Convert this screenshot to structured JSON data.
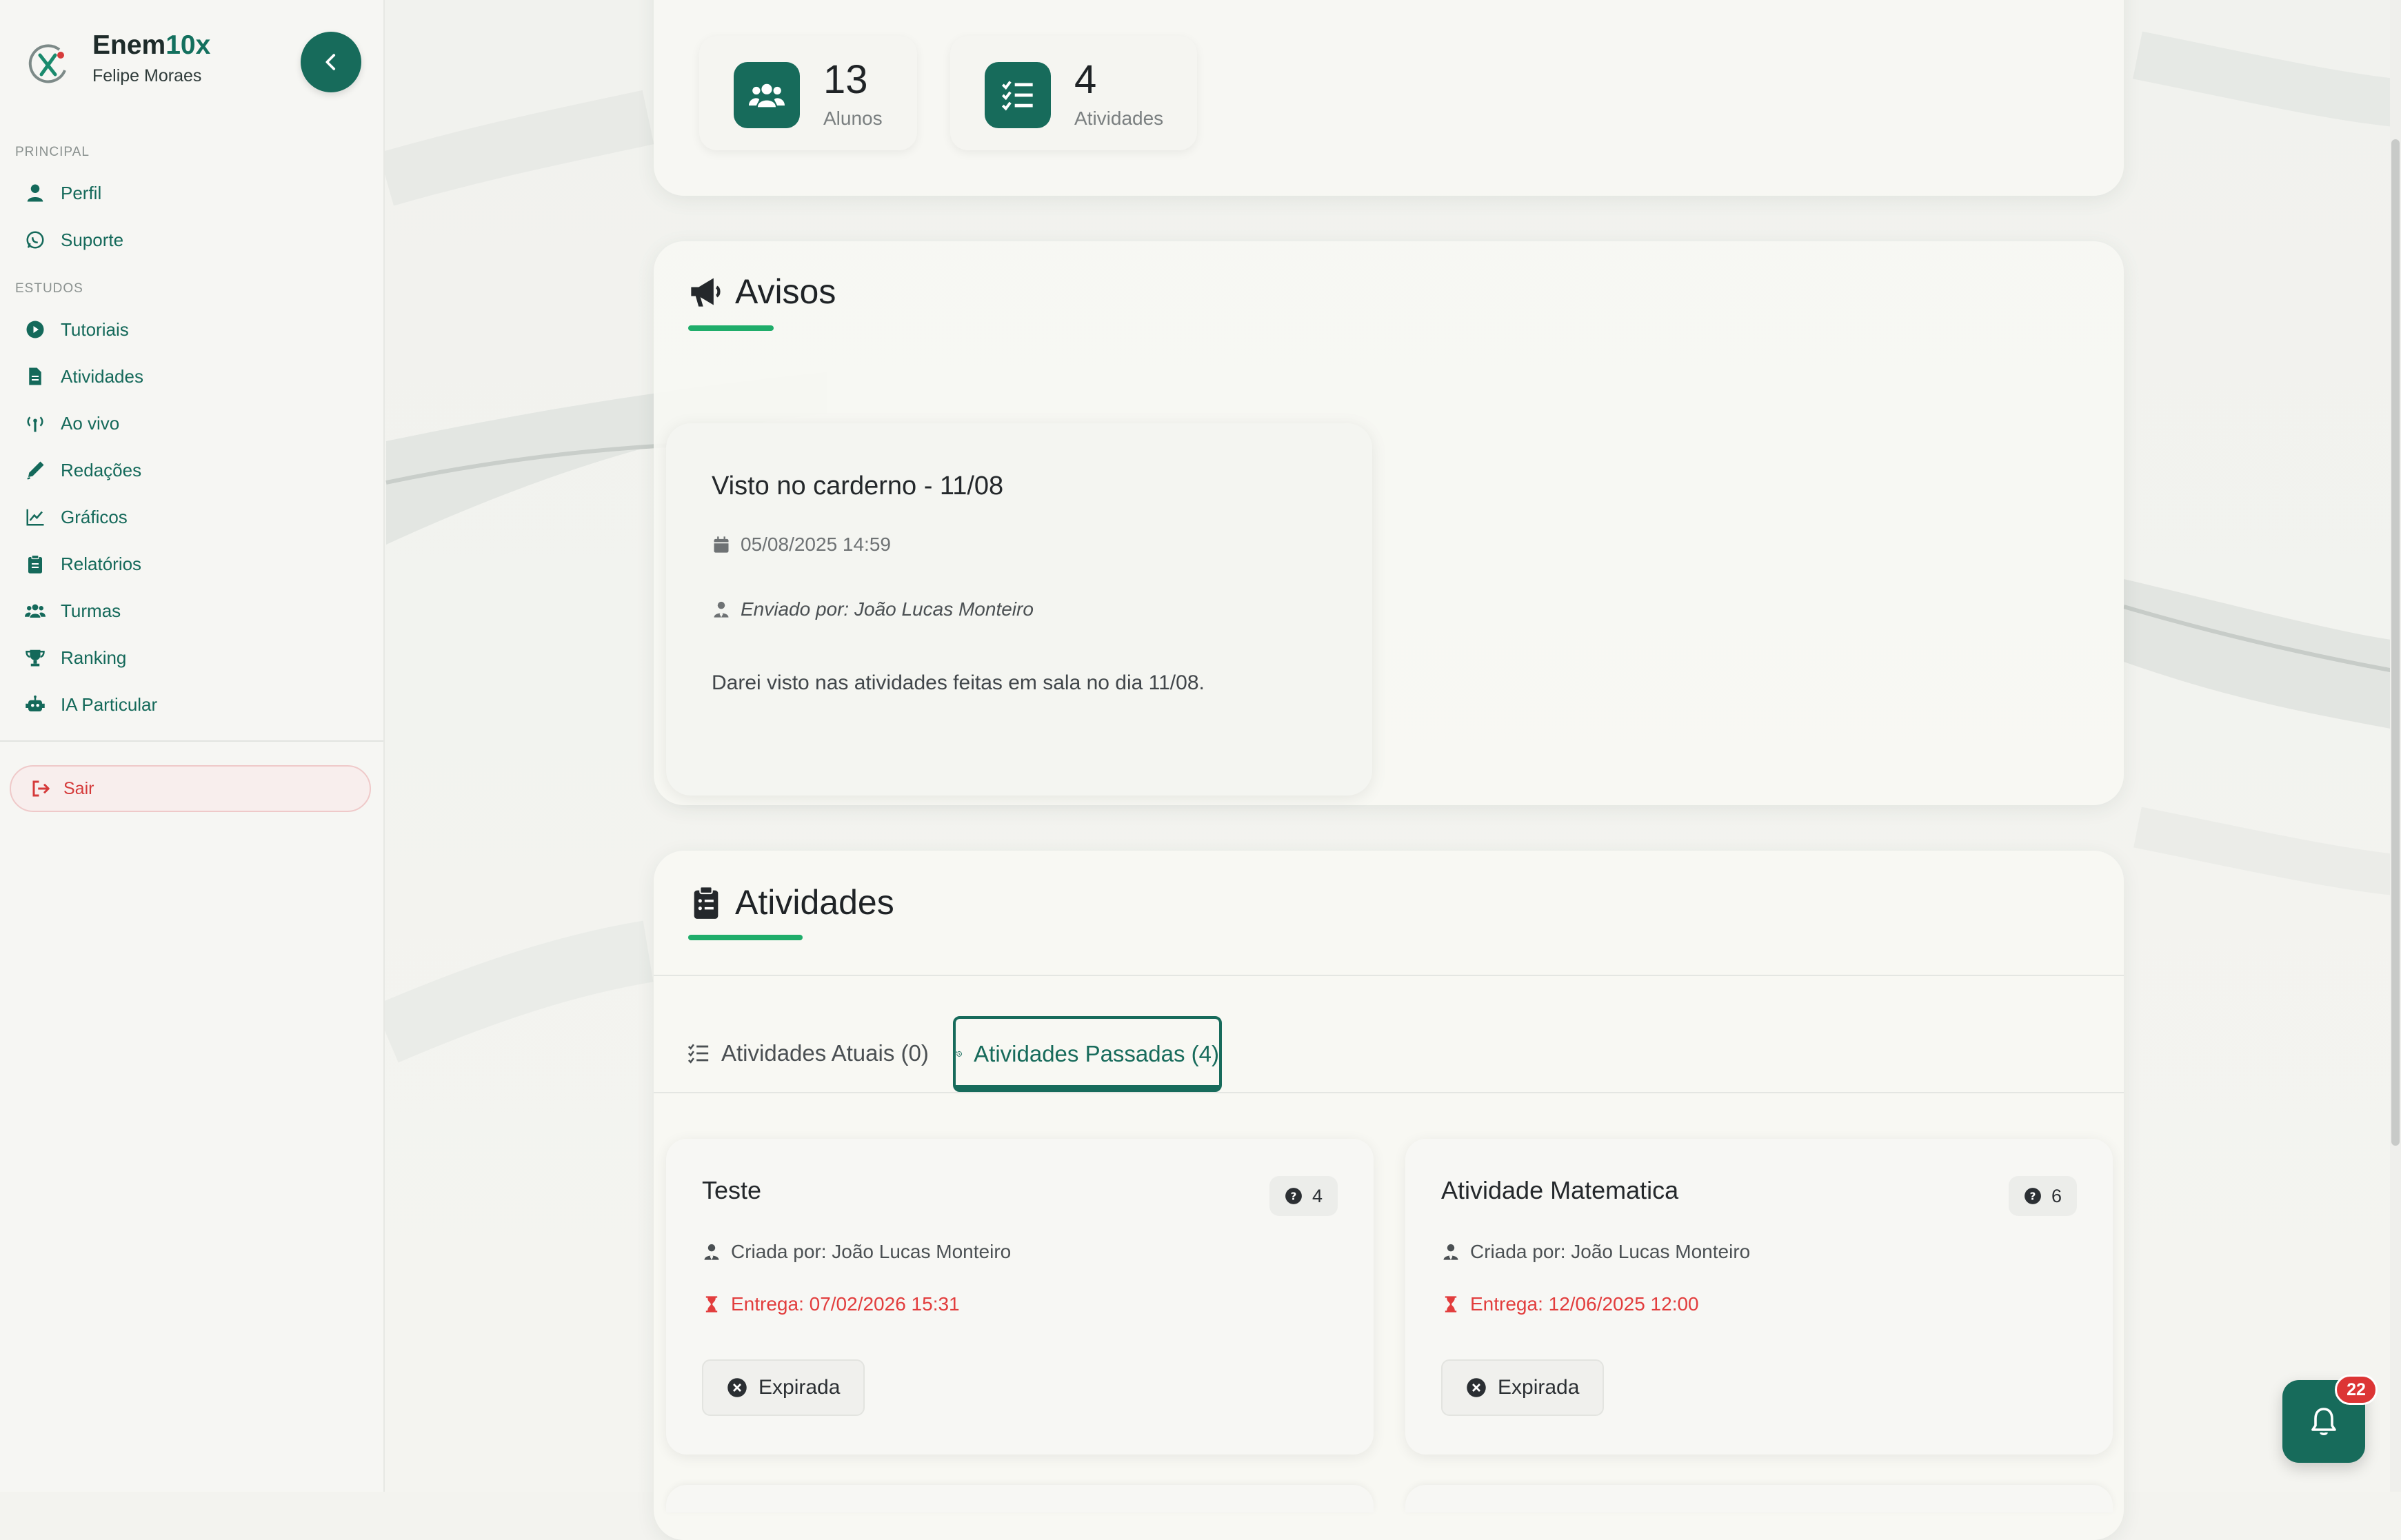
{
  "app": {
    "brand_prefix": "Enem",
    "brand_accent": "10x",
    "user_name": "Felipe Moraes"
  },
  "sidebar": {
    "sections": [
      {
        "label": "PRINCIPAL"
      },
      {
        "label": "ESTUDOS"
      }
    ],
    "items": [
      {
        "label": "Perfil",
        "icon": "user-icon"
      },
      {
        "label": "Suporte",
        "icon": "whatsapp-icon"
      },
      {
        "label": "Tutoriais",
        "icon": "play-circle-icon"
      },
      {
        "label": "Atividades",
        "icon": "file-icon"
      },
      {
        "label": "Ao vivo",
        "icon": "broadcast-icon"
      },
      {
        "label": "Redações",
        "icon": "pen-icon"
      },
      {
        "label": "Gráficos",
        "icon": "line-chart-icon"
      },
      {
        "label": "Relatórios",
        "icon": "clipboard-icon"
      },
      {
        "label": "Turmas",
        "icon": "users-icon"
      },
      {
        "label": "Ranking",
        "icon": "trophy-icon"
      },
      {
        "label": "IA Particular",
        "icon": "robot-icon"
      }
    ],
    "logout_label": "Sair"
  },
  "stats": [
    {
      "value": "13",
      "label": "Alunos",
      "icon": "users-icon"
    },
    {
      "value": "4",
      "label": "Atividades",
      "icon": "list-check-icon"
    }
  ],
  "notices": {
    "title": "Avisos",
    "items": [
      {
        "title": "Visto no carderno - 11/08",
        "date": "05/08/2025 14:59",
        "sender": "Enviado por: João Lucas Monteiro",
        "body": "Darei visto nas atividades feitas em sala no dia 11/08."
      }
    ]
  },
  "activities": {
    "title": "Atividades",
    "tabs": [
      {
        "label": "Atividades Atuais (0)",
        "active": false
      },
      {
        "label": "Atividades Passadas (4)",
        "active": true
      }
    ],
    "items": [
      {
        "title": "Teste",
        "question_count": "4",
        "author": "Criada por: João Lucas Monteiro",
        "due": "Entrega: 07/02/2026 15:31",
        "status": "Expirada"
      },
      {
        "title": "Atividade Matematica",
        "question_count": "6",
        "author": "Criada por: João Lucas Monteiro",
        "due": "Entrega: 12/06/2025 12:00",
        "status": "Expirada"
      }
    ]
  },
  "notifications": {
    "count": "22"
  },
  "colors": {
    "primary": "#176b5b",
    "accent": "#1fad6a",
    "danger": "#e23d3d"
  }
}
